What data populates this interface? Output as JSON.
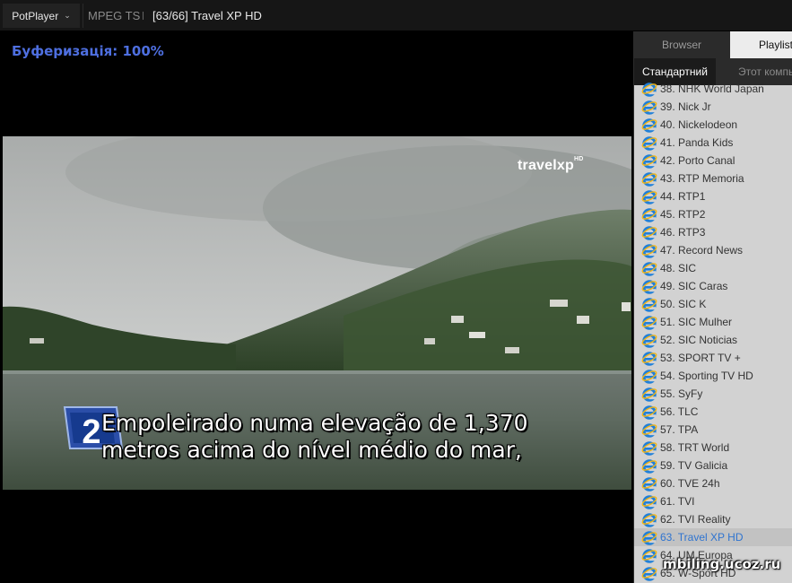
{
  "titlebar": {
    "app_menu": "PotPlayer",
    "format": "MPEG TS",
    "title": "[63/66] Travel XP HD"
  },
  "osd": {
    "buffering": "Буферизація: 100%"
  },
  "video": {
    "logo": "travelxp",
    "logo_sup": "HD",
    "badge_number": "2",
    "subtitle_line1": "Empoleirado numa elevação de 1,370",
    "subtitle_line2": "metros acima do nível médio do mar,"
  },
  "panel": {
    "tabs": [
      "Browser",
      "Playlist"
    ],
    "active_tab": "Playlist",
    "subtabs": [
      "Стандартний",
      "Этот компь"
    ],
    "active_subtab": "Стандартний",
    "items": [
      "38. NHK World Japan",
      "39. Nick Jr",
      "40. Nickelodeon",
      "41. Panda Kids",
      "42. Porto Canal",
      "43. RTP Memoria",
      "44. RTP1",
      "45. RTP2",
      "46. RTP3",
      "47. Record News",
      "48. SIC",
      "49. SIC Caras",
      "50. SIC K",
      "51. SIC Mulher",
      "52. SIC Noticias",
      "53. SPORT TV +",
      "54. Sporting TV HD",
      "55. SyFy",
      "56. TLC",
      "57. TPA",
      "58. TRT World",
      "59. TV Galicia",
      "60. TVE 24h",
      "61. TVI",
      "62. TVI Reality",
      "63. Travel XP HD",
      "64. UM Europa",
      "65. W-Sport HD"
    ],
    "active_item": "63. Travel XP HD",
    "item_icon": "internet-explorer-icon"
  },
  "watermark": "mbiling.ucoz.ru",
  "colors": {
    "osd": "#4e6fe0",
    "active_item": "#2f74d0",
    "panel_bg": "#d2d2d2"
  }
}
